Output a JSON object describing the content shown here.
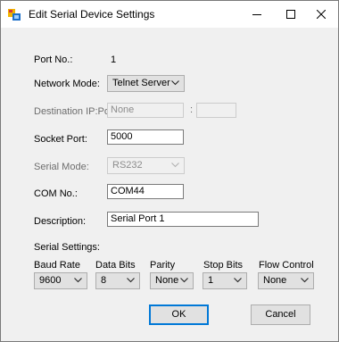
{
  "window": {
    "title": "Edit Serial Device Settings",
    "minimize_glyph": "—",
    "maximize_glyph": "☐",
    "close_glyph": "✕"
  },
  "port": {
    "label": "Port No.:",
    "value": "1"
  },
  "network_mode": {
    "label": "Network Mode:",
    "value": "Telnet Server"
  },
  "destination": {
    "label": "Destination IP:Port:",
    "ip_value": "None",
    "separator": ":",
    "port_value": ""
  },
  "socket_port": {
    "label": "Socket Port:",
    "value": "5000"
  },
  "serial_mode": {
    "label": "Serial Mode:",
    "value": "RS232"
  },
  "com_no": {
    "label": "COM No.:",
    "value": "COM44"
  },
  "description": {
    "label": "Description:",
    "value": "Serial Port 1"
  },
  "serial_settings": {
    "label": "Serial Settings:",
    "baud_rate": {
      "label": "Baud Rate",
      "value": "9600"
    },
    "data_bits": {
      "label": "Data Bits",
      "value": "8"
    },
    "parity": {
      "label": "Parity",
      "value": "None"
    },
    "stop_bits": {
      "label": "Stop Bits",
      "value": "1"
    },
    "flow_control": {
      "label": "Flow Control",
      "value": "None"
    }
  },
  "buttons": {
    "ok": "OK",
    "cancel": "Cancel"
  },
  "icons": {
    "app": "serial-device-icon",
    "dropdown": "chevron-down-icon"
  },
  "colors": {
    "accent": "#0078d7",
    "dialog_bg": "#f0f0f0",
    "disabled_text": "#6d6d6d"
  }
}
